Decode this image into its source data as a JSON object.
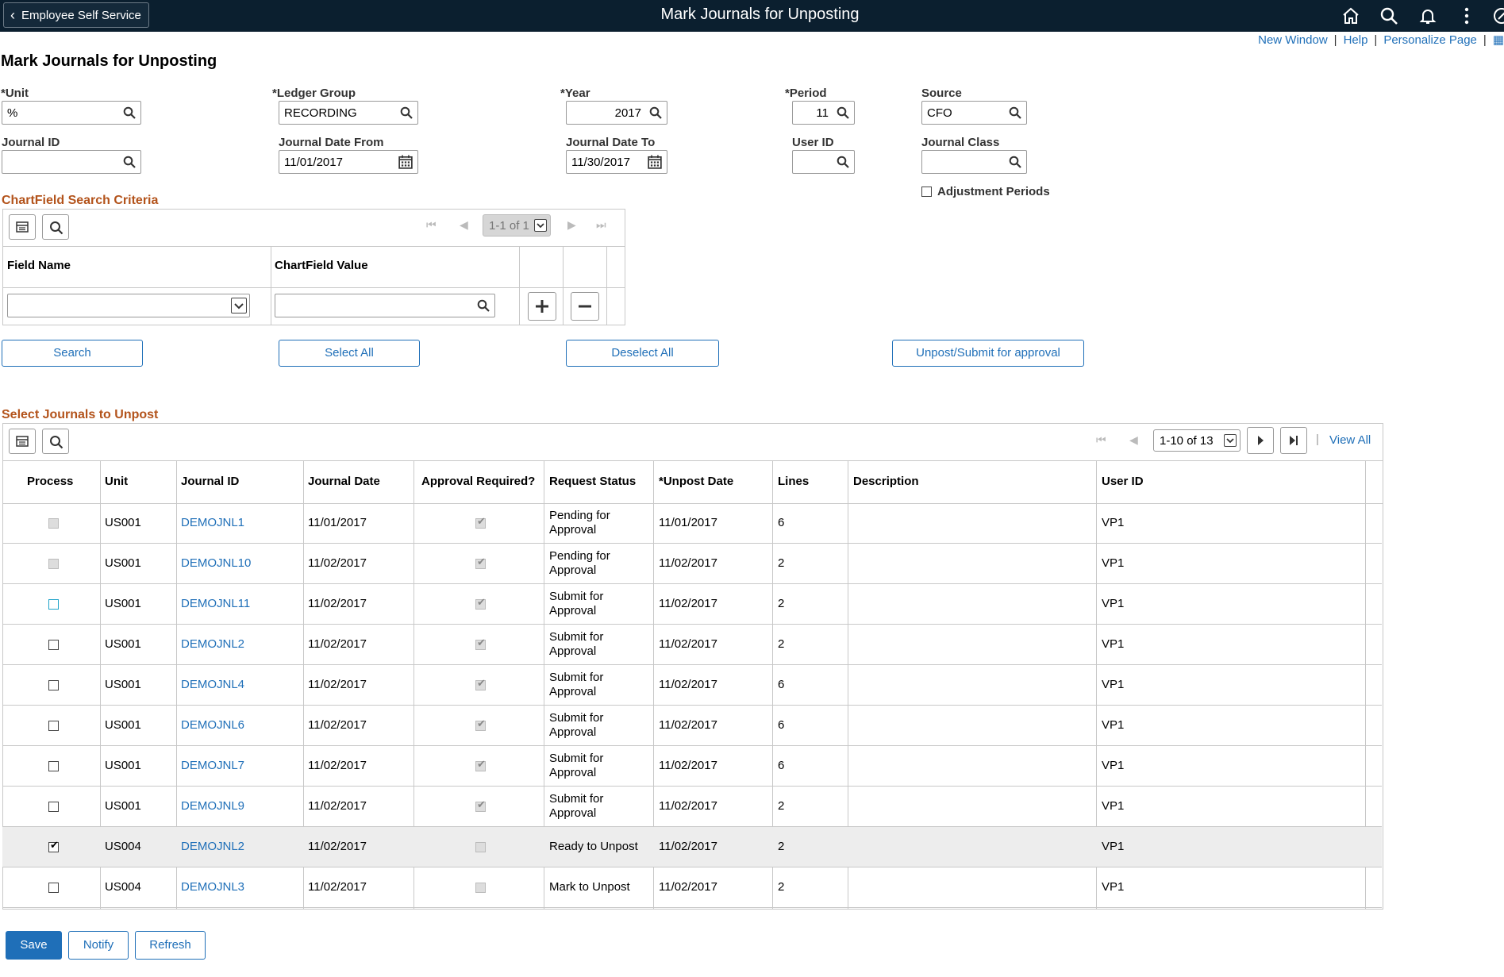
{
  "header": {
    "back_label": "Employee Self Service",
    "title": "Mark Journals for Unposting",
    "icons": [
      "home-icon",
      "search-icon",
      "bell-icon",
      "more-icon",
      "nav-circle-icon"
    ]
  },
  "links": {
    "new_window": "New Window",
    "help": "Help",
    "personalize": "Personalize Page",
    "sep": "|"
  },
  "page_title": "Mark Journals for Unposting",
  "form": {
    "unit": {
      "label": "*Unit",
      "value": "%"
    },
    "ledger_group": {
      "label": "*Ledger Group",
      "value": "RECORDING"
    },
    "year": {
      "label": "*Year",
      "value": "2017"
    },
    "period": {
      "label": "*Period",
      "value": "11"
    },
    "source": {
      "label": "Source",
      "value": "CFO"
    },
    "journal_id": {
      "label": "Journal ID",
      "value": ""
    },
    "journal_date_from": {
      "label": "Journal Date From",
      "value": "11/01/2017"
    },
    "journal_date_to": {
      "label": "Journal Date To",
      "value": "11/30/2017"
    },
    "user_id": {
      "label": "User ID",
      "value": ""
    },
    "journal_class": {
      "label": "Journal Class",
      "value": ""
    },
    "adjustment_periods": {
      "label": "Adjustment Periods",
      "checked": false
    }
  },
  "chartfield": {
    "title": "ChartField Search Criteria",
    "pager": "1-1 of 1",
    "col_field_name": "Field Name",
    "col_chartfield_value": "ChartField Value"
  },
  "actions": {
    "search": "Search",
    "select_all": "Select All",
    "deselect_all": "Deselect All",
    "unpost_submit": "Unpost/Submit for approval"
  },
  "journals": {
    "title": "Select Journals to Unpost",
    "pager": "1-10 of 13",
    "view_all": "View All",
    "columns": [
      "Process",
      "Unit",
      "Journal ID",
      "Journal Date",
      "Approval Required?",
      "Request Status",
      "*Unpost Date",
      "Lines",
      "Description",
      "User ID"
    ],
    "rows": [
      {
        "process": "disabled",
        "unit": "US001",
        "journal_id": "DEMOJNL1",
        "journal_date": "11/01/2017",
        "approval": "checked-disabled",
        "status1": "Pending for",
        "status2": "Approval",
        "unpost_date": "11/01/2017",
        "lines": "6",
        "description": "",
        "user_id": "VP1"
      },
      {
        "process": "disabled",
        "unit": "US001",
        "journal_id": "DEMOJNL10",
        "journal_date": "11/02/2017",
        "approval": "checked-disabled",
        "status1": "Pending for",
        "status2": "Approval",
        "unpost_date": "11/02/2017",
        "lines": "2",
        "description": "",
        "user_id": "VP1"
      },
      {
        "process": "focus",
        "unit": "US001",
        "journal_id": "DEMOJNL11",
        "journal_date": "11/02/2017",
        "approval": "checked-disabled",
        "status1": "Submit for",
        "status2": "Approval",
        "unpost_date": "11/02/2017",
        "lines": "2",
        "description": "",
        "user_id": "VP1"
      },
      {
        "process": "unchecked",
        "unit": "US001",
        "journal_id": "DEMOJNL2",
        "journal_date": "11/02/2017",
        "approval": "checked-disabled",
        "status1": "Submit for",
        "status2": "Approval",
        "unpost_date": "11/02/2017",
        "lines": "2",
        "description": "",
        "user_id": "VP1"
      },
      {
        "process": "unchecked",
        "unit": "US001",
        "journal_id": "DEMOJNL4",
        "journal_date": "11/02/2017",
        "approval": "checked-disabled",
        "status1": "Submit for",
        "status2": "Approval",
        "unpost_date": "11/02/2017",
        "lines": "6",
        "description": "",
        "user_id": "VP1"
      },
      {
        "process": "unchecked",
        "unit": "US001",
        "journal_id": "DEMOJNL6",
        "journal_date": "11/02/2017",
        "approval": "checked-disabled",
        "status1": "Submit for",
        "status2": "Approval",
        "unpost_date": "11/02/2017",
        "lines": "6",
        "description": "",
        "user_id": "VP1"
      },
      {
        "process": "unchecked",
        "unit": "US001",
        "journal_id": "DEMOJNL7",
        "journal_date": "11/02/2017",
        "approval": "checked-disabled",
        "status1": "Submit for",
        "status2": "Approval",
        "unpost_date": "11/02/2017",
        "lines": "6",
        "description": "",
        "user_id": "VP1"
      },
      {
        "process": "unchecked",
        "unit": "US001",
        "journal_id": "DEMOJNL9",
        "journal_date": "11/02/2017",
        "approval": "checked-disabled",
        "status1": "Submit for",
        "status2": "Approval",
        "unpost_date": "11/02/2017",
        "lines": "2",
        "description": "",
        "user_id": "VP1"
      },
      {
        "process": "checked",
        "unit": "US004",
        "journal_id": "DEMOJNL2",
        "journal_date": "11/02/2017",
        "approval": "unchecked-disabled",
        "status1": "Ready to Unpost",
        "status2": "",
        "unpost_date": "11/02/2017",
        "lines": "2",
        "description": "",
        "user_id": "VP1"
      },
      {
        "process": "unchecked",
        "unit": "US004",
        "journal_id": "DEMOJNL3",
        "journal_date": "11/02/2017",
        "approval": "unchecked-disabled",
        "status1": "Mark to Unpost",
        "status2": "",
        "unpost_date": "11/02/2017",
        "lines": "2",
        "description": "",
        "user_id": "VP1"
      }
    ]
  },
  "footer": {
    "save": "Save",
    "notify": "Notify",
    "refresh": "Refresh"
  },
  "colors": {
    "header_bg": "#0b1f2f",
    "link": "#1f6fb8",
    "section_title": "#b3531b",
    "selected_row": "#ededed"
  }
}
